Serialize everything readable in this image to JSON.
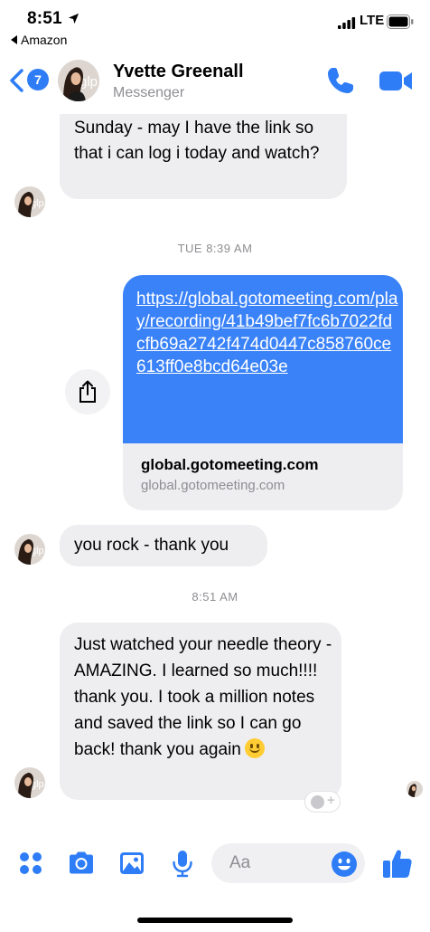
{
  "status_bar": {
    "time": "8:51",
    "back_app": "Amazon",
    "network": "LTE"
  },
  "header": {
    "unread_count": "7",
    "contact_name": "Yvette Greenall",
    "subtitle": "Messenger",
    "avatar_initials": "glp"
  },
  "messages": {
    "msg1_text": "get onto the lives session this past Sunday - may I have the link so that i can log i today and watch?",
    "timestamp1": "TUE 8:39 AM",
    "link_url": "https://global.gotomeeting.com/play/recording/41b49bef7fc6b7022fdcfb69a2742f474d0447c858760ce613ff0e8bcd64e03e",
    "link_title": "global.gotomeeting.com",
    "link_domain": "global.gotomeeting.com",
    "msg2_text": "you rock - thank you",
    "timestamp2": "8:51 AM",
    "msg3_text": "Just watched your needle theory - AMAZING.  I learned so much!!!! thank you.  I took a million notes and saved the link so I can go back! thank you again"
  },
  "composer": {
    "placeholder": "Aa"
  },
  "colors": {
    "accent": "#2f7df6",
    "outgoing_bubble": "#3a82f7",
    "incoming_bubble": "#eeeef0"
  },
  "icons": [
    "location-arrow-icon",
    "signal-icon",
    "battery-icon",
    "chevron-left-icon",
    "phone-icon",
    "video-camera-icon",
    "share-icon",
    "add-reaction-icon",
    "apps-grid-icon",
    "camera-icon",
    "image-icon",
    "microphone-icon",
    "emoji-icon",
    "thumbs-up-icon"
  ]
}
